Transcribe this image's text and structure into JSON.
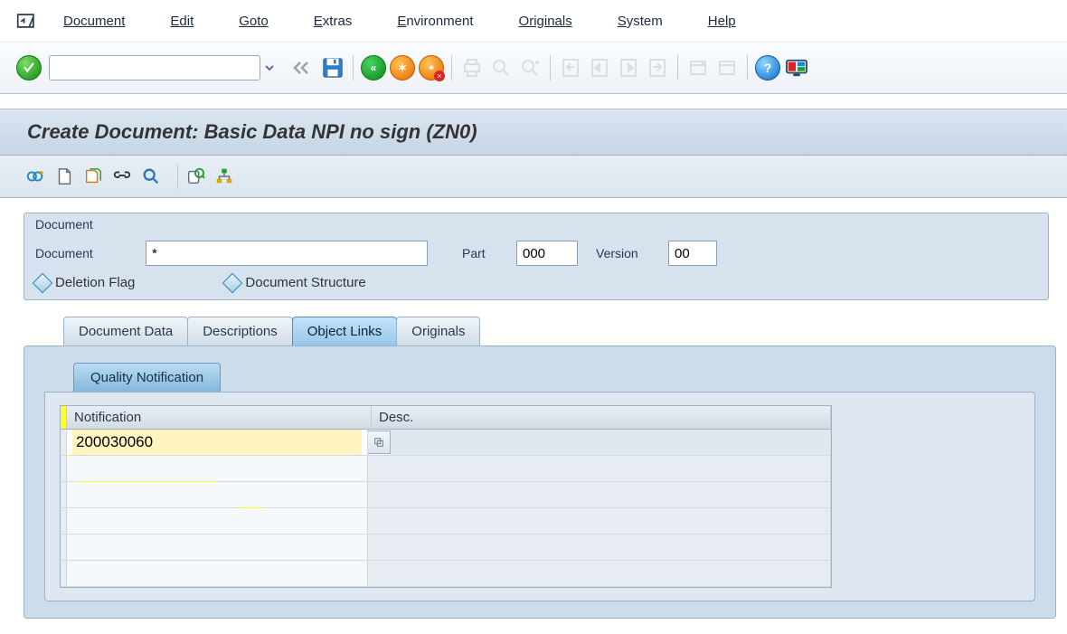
{
  "menu": {
    "document": "Document",
    "edit": "Edit",
    "goto": "Goto",
    "extras": "Extras",
    "environment": "Environment",
    "originals": "Originals",
    "system": "System",
    "help": "Help"
  },
  "toolbar": {
    "okcode": ""
  },
  "title": "Create Document: Basic Data NPI no sign (ZN0)",
  "group": {
    "title": "Document",
    "doc_label": "Document",
    "doc_value": "*",
    "part_label": "Part",
    "part_value": "000",
    "version_label": "Version",
    "version_value": "00",
    "deletion_flag": "Deletion Flag",
    "doc_structure": "Document Structure"
  },
  "tabs": {
    "docdata": "Document Data",
    "descriptions": "Descriptions",
    "objlinks": "Object Links",
    "originals": "Originals"
  },
  "subtab": {
    "qn": "Quality Notification"
  },
  "table": {
    "col_notification": "Notification",
    "col_desc": "Desc.",
    "row1_notif": "200030060"
  }
}
